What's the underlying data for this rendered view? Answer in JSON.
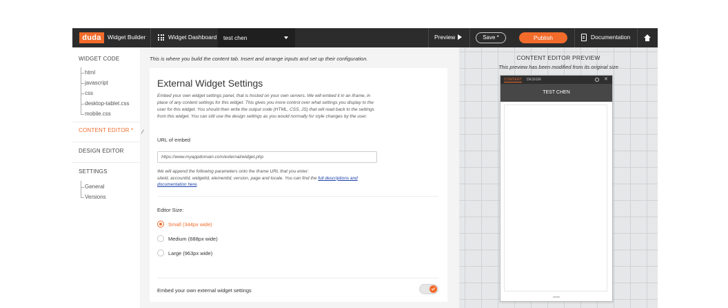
{
  "topbar": {
    "logo": "duda",
    "app_name": "Widget Builder",
    "dashboard_label": "Widget Dashboard",
    "widget_select": "test chen",
    "preview_label": "Preview",
    "save_label": "Save *",
    "publish_label": "Publish",
    "documentation_label": "Documentation"
  },
  "sidebar": {
    "widget_code_heading": "WIDGET CODE",
    "code_files": [
      "html",
      "javascript",
      "css",
      "desktop-tablet.css",
      "mobile.css"
    ],
    "content_editor": "CONTENT EDITOR *",
    "design_editor": "DESIGN EDITOR",
    "settings_heading": "SETTINGS",
    "settings_items": [
      "General",
      "Versions"
    ]
  },
  "main": {
    "hint": "This is where you build the content tab. Insert and arrange inputs and set up their configuration.",
    "card": {
      "title": "External Widget Settings",
      "description": "Embed your own widget settings panel, that is hosted on your own servers. We will embed it in an iframe, in place of any content settings for this widget. This gives you more control over what settings you display to the user for this widget. You should then write the output code (HTML, CSS, JS) that will read back to the settings from this widget. You can still use the design settings as you would normally for style changes by the user.",
      "url_label": "URL of embed",
      "url_placeholder": "https://www.myappdomain.com/external/widget.php",
      "append_note_1": "We will append the following parameters onto the iframe URL that you enter:",
      "append_note_2": "siteId, accountId, widgetId, elementId, version, page and locale. You can find the ",
      "append_link": "full descriptions and documentation here",
      "append_end": ".",
      "editor_size_label": "Editor Size:",
      "sizes": [
        {
          "label": "Small (344px wide)",
          "selected": true
        },
        {
          "label": "Medium (688px wide)",
          "selected": false
        },
        {
          "label": "Large (963px wide)",
          "selected": false
        }
      ],
      "embed_toggle_label": "Embed your own external widget settings",
      "embed_toggle_on": true
    }
  },
  "preview": {
    "title": "CONTENT EDITOR PREVIEW",
    "subtitle": "This preview has been modified from its original size",
    "tab_content": "CONTENT",
    "tab_design": "DESIGN",
    "header": "TEST CHEN"
  },
  "colors": {
    "accent": "#f26b2b",
    "topbar": "#2c2c2c",
    "link": "#1a3fa8"
  }
}
